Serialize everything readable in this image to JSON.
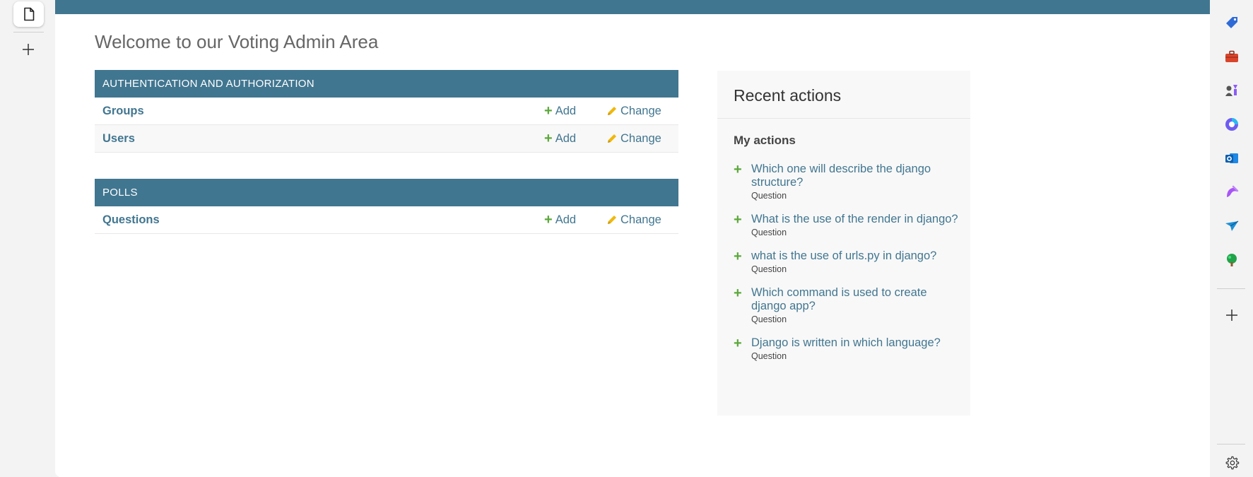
{
  "page": {
    "welcome": "Welcome to our Voting Admin Area"
  },
  "modules": [
    {
      "caption": "AUTHENTICATION AND AUTHORIZATION",
      "rows": [
        {
          "name": "Groups",
          "add": "Add",
          "change": "Change"
        },
        {
          "name": "Users",
          "add": "Add",
          "change": "Change"
        }
      ]
    },
    {
      "caption": "POLLS",
      "rows": [
        {
          "name": "Questions",
          "add": "Add",
          "change": "Change"
        }
      ]
    }
  ],
  "recent": {
    "heading": "Recent actions",
    "subheading": "My actions",
    "items": [
      {
        "title": "Which one will describe the django structure?",
        "type": "Question"
      },
      {
        "title": "What is the use of the render in django?",
        "type": "Question"
      },
      {
        "title": "what is the use of urls.py in django?",
        "type": "Question"
      },
      {
        "title": "Which command is used to create django app?",
        "type": "Question"
      },
      {
        "title": "Django is written in which language?",
        "type": "Question"
      }
    ]
  },
  "sidebar": {
    "icons": [
      "tag-icon",
      "briefcase-icon",
      "chess-icon",
      "copilot-icon",
      "outlook-icon",
      "designer-icon",
      "send-icon",
      "tree-icon"
    ]
  },
  "colors": {
    "header": "#417690",
    "link": "#417690",
    "add_green": "#5ba83a",
    "change_yellow": "#efb80b"
  }
}
